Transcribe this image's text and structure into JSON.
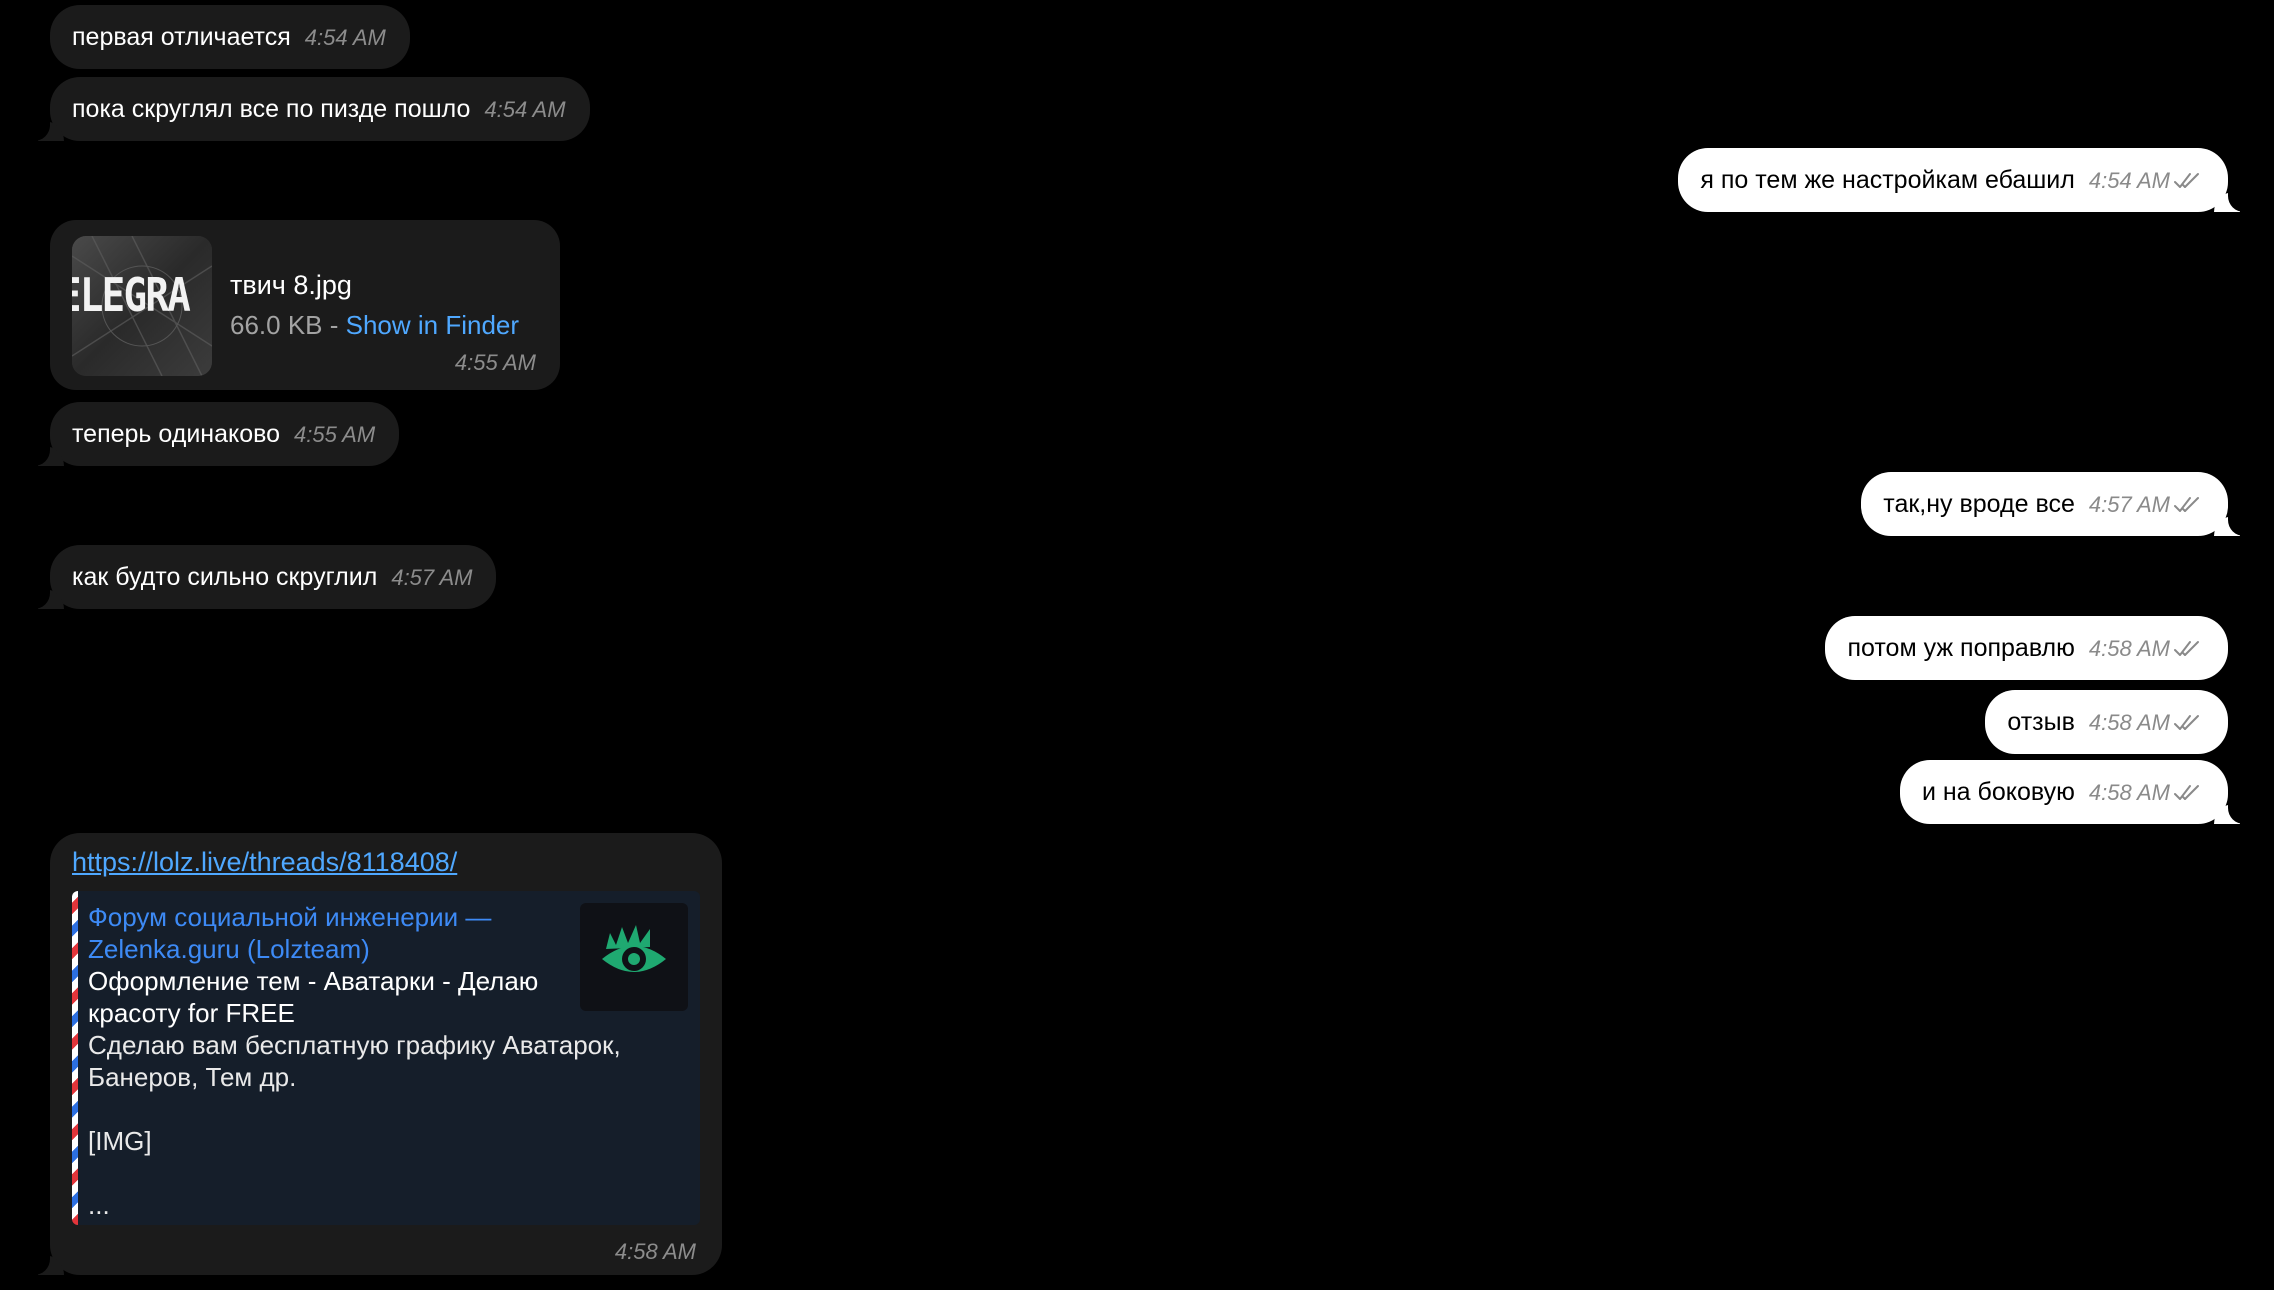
{
  "messages": {
    "m1": {
      "text": "первая отличается",
      "time": "4:54 AM"
    },
    "m2": {
      "text": "пока скруглял все по пизде пошло",
      "time": "4:54 AM"
    },
    "m3": {
      "text": "я по тем же настройкам ебашил",
      "time": "4:54 AM"
    },
    "file": {
      "name": "твич 8.jpg",
      "size": "66.0 KB",
      "separator": " - ",
      "action": "Show in Finder",
      "time": "4:55 AM",
      "thumb_text": "ELEGRA"
    },
    "m5": {
      "text": "теперь одинаково",
      "time": "4:55 AM"
    },
    "m6": {
      "text": "так,ну вроде все",
      "time": "4:57 AM"
    },
    "m7": {
      "text": "как будто сильно скруглил",
      "time": "4:57 AM"
    },
    "m8": {
      "text": "потом уж поправлю",
      "time": "4:58 AM"
    },
    "m9": {
      "text": "отзыв",
      "time": "4:58 AM"
    },
    "m10": {
      "text": "и на боковую",
      "time": "4:58 AM"
    },
    "link": {
      "url": "https://lolz.live/threads/8118408/",
      "site": "Форум социальной инженерии — Zelenka.guru (Lolzteam)",
      "title": "Оформление тем - Аватарки - Делаю красоту for FREE",
      "description": "Сделаю вам бесплатную графику Аватарок, Банеров, Тем др.",
      "img_tag": "[IMG]",
      "ellipsis": "...",
      "time": "4:58 AM"
    }
  },
  "colors": {
    "background": "#000000",
    "incoming_bubble": "#1b1b1b",
    "outgoing_bubble": "#ffffff",
    "link": "#4fa8ff",
    "preview_site": "#3d8af5",
    "preview_bg": "#151e2a",
    "icon_green": "#1fa971"
  }
}
